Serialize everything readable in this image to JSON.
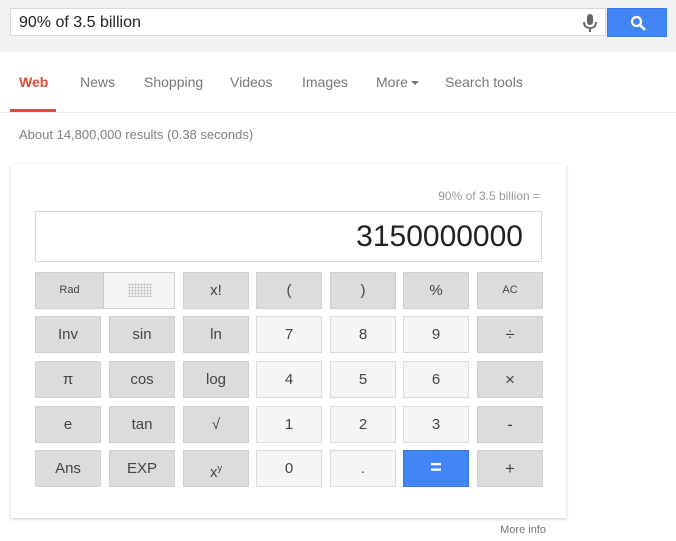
{
  "search": {
    "query": "90% of 3.5 billion"
  },
  "tabs": [
    {
      "label": "Web",
      "active": true
    },
    {
      "label": "News"
    },
    {
      "label": "Shopping"
    },
    {
      "label": "Videos"
    },
    {
      "label": "Images"
    },
    {
      "label": "More"
    },
    {
      "label": "Search tools"
    }
  ],
  "stats": "About 14,800,000 results (0.38 seconds)",
  "calculator": {
    "expression": "90% of 3.5 billion =",
    "result": "3150000000",
    "keys": {
      "rad": "Rad",
      "fact": "x!",
      "lparen": "(",
      "rparen": ")",
      "percent": "%",
      "ac": "AC",
      "inv": "Inv",
      "sin": "sin",
      "ln": "ln",
      "k7": "7",
      "k8": "8",
      "k9": "9",
      "divide": "÷",
      "pi": "π",
      "cos": "cos",
      "log": "log",
      "k4": "4",
      "k5": "5",
      "k6": "6",
      "multiply": "×",
      "e": "e",
      "tan": "tan",
      "sqrt": "√",
      "k1": "1",
      "k2": "2",
      "k3": "3",
      "minus": "-",
      "ans": "Ans",
      "exp": "EXP",
      "k0": "0",
      "dot": ".",
      "equals": "=",
      "plus": "+"
    }
  },
  "more_info": "More info",
  "colors": {
    "accent": "#4285f4",
    "active_tab": "#dd4b39"
  }
}
